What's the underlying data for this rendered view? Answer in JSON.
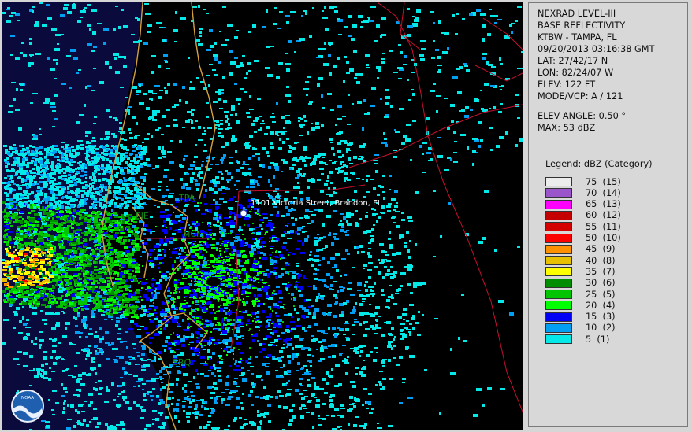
{
  "info": {
    "lines_top": [
      "NEXRAD LEVEL-III",
      "BASE REFLECTIVITY",
      "KTBW - TAMPA, FL",
      "09/20/2013 03:16:38 GMT",
      "LAT: 27/42/17 N",
      "LON: 82/24/07 W",
      "ELEV: 122 FT",
      "MODE/VCP: A / 121"
    ],
    "lines_bottom": [
      "ELEV ANGLE: 0.50 °",
      "MAX: 53 dBZ"
    ]
  },
  "legend": {
    "title": "Legend: dBZ (Category)",
    "items": [
      {
        "label": "75  (15)",
        "color": "#ececec"
      },
      {
        "label": "70  (14)",
        "color": "#9955c9"
      },
      {
        "label": "65  (13)",
        "color": "#ff00ff"
      },
      {
        "label": "60  (12)",
        "color": "#c40000"
      },
      {
        "label": "55  (11)",
        "color": "#d40000"
      },
      {
        "label": "50  (10)",
        "color": "#ff0000"
      },
      {
        "label": "45  (9)",
        "color": "#ff9000"
      },
      {
        "label": "40  (8)",
        "color": "#e7c000"
      },
      {
        "label": "35  (7)",
        "color": "#ffff00"
      },
      {
        "label": "30  (6)",
        "color": "#008e00"
      },
      {
        "label": "25  (5)",
        "color": "#01c501"
      },
      {
        "label": "20  (4)",
        "color": "#00ff00"
      },
      {
        "label": "15  (3)",
        "color": "#0000f6"
      },
      {
        "label": "10  (2)",
        "color": "#019ff4"
      },
      {
        "label": "5  (1)",
        "color": "#04e9e7"
      }
    ]
  },
  "radar": {
    "address_label": "1101 Victoria Street, Brandon, FL",
    "stations": [
      {
        "code": "TPA"
      },
      {
        "code": "PIE"
      },
      {
        "code": "MCF"
      },
      {
        "code": "SRQ"
      }
    ],
    "logo_text": "NOAA"
  },
  "colors": {
    "background": "#000000",
    "water": "#0a0a3c",
    "county_lines": "#c8102e",
    "coastline": "#d4a040"
  }
}
